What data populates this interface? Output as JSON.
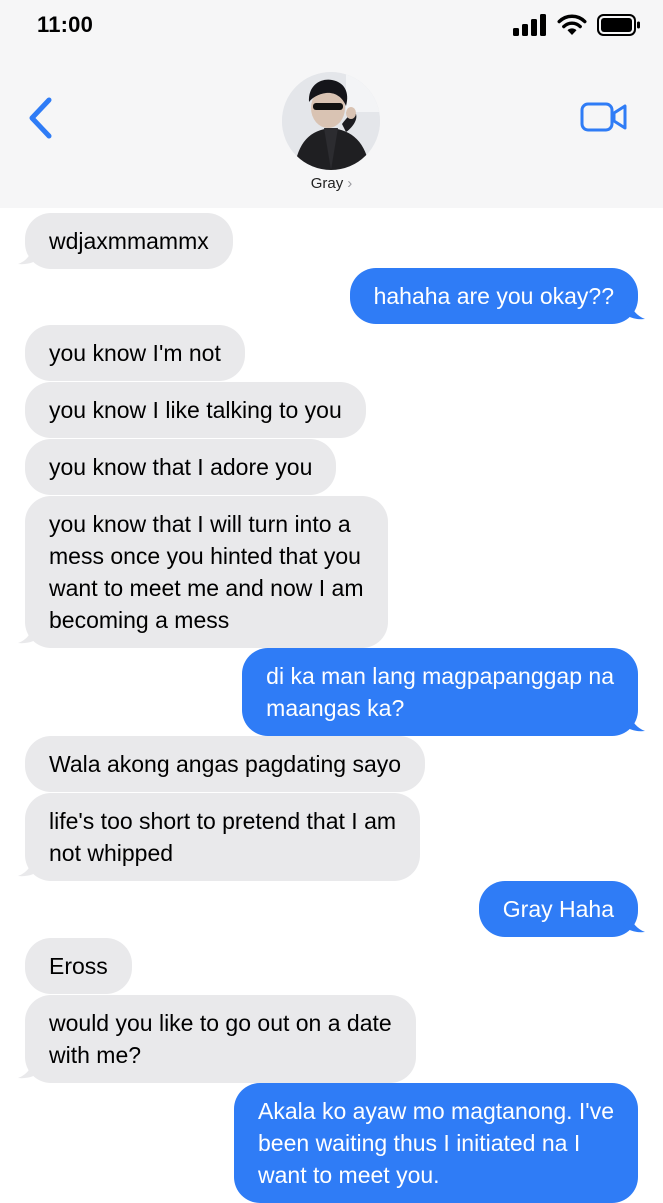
{
  "status_bar": {
    "time": "11:00"
  },
  "contact": {
    "name": "Gray",
    "chevron": "›"
  },
  "icons": {
    "back": "chevron-left-icon",
    "video": "video-camera-icon",
    "signal": "cellular-signal-icon",
    "wifi": "wifi-icon",
    "battery": "battery-icon"
  },
  "colors": {
    "outgoing": "#2f7cf6",
    "incoming": "#e9e9eb",
    "accent": "#2f7cf6"
  },
  "messages": [
    {
      "from": "them",
      "lines": [
        "wdjaxmmammx"
      ]
    },
    {
      "from": "me",
      "lines": [
        "hahaha are you okay??"
      ]
    },
    {
      "from": "them",
      "lines": [
        "you know I'm not"
      ]
    },
    {
      "from": "them",
      "lines": [
        "you know I like talking to you"
      ]
    },
    {
      "from": "them",
      "lines": [
        "you know that I adore you"
      ]
    },
    {
      "from": "them",
      "lines": [
        "you know that I will turn into a",
        "mess once you hinted that you",
        "want to meet me and now I am",
        "becoming a mess"
      ]
    },
    {
      "from": "me",
      "lines": [
        "di ka man lang magpapanggap na",
        "maangas ka?"
      ]
    },
    {
      "from": "them",
      "lines": [
        "Wala akong angas pagdating sayo"
      ]
    },
    {
      "from": "them",
      "lines": [
        "life's too short to pretend that I am",
        "not whipped"
      ]
    },
    {
      "from": "me",
      "lines": [
        "Gray Haha"
      ]
    },
    {
      "from": "them",
      "lines": [
        "Eross"
      ]
    },
    {
      "from": "them",
      "lines": [
        "would you like to go out on a date",
        "with me?"
      ]
    },
    {
      "from": "me",
      "lines": [
        "Akala ko ayaw mo magtanong. I've",
        "been waiting thus I initiated na I",
        "want to meet you."
      ]
    }
  ]
}
